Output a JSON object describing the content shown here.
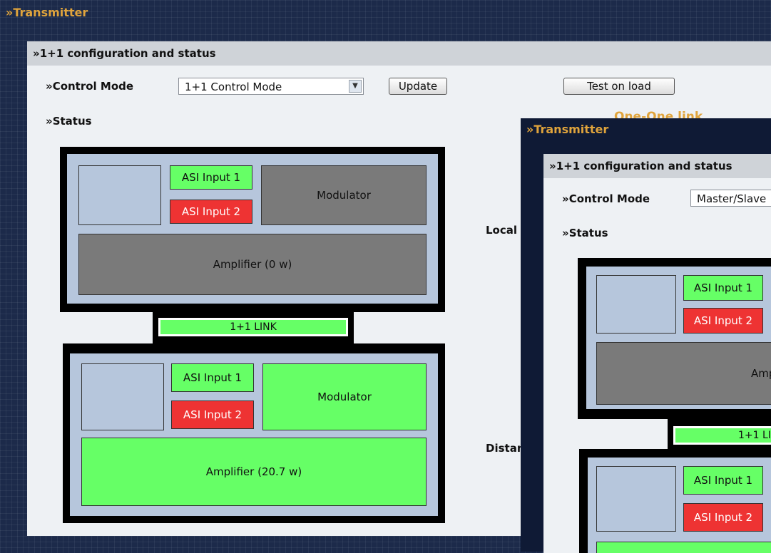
{
  "back_window": {
    "title": "»Transmitter",
    "panel_header": "»1+1 configuration and status",
    "control_mode_label": "»Control Mode",
    "control_mode_value": "1+1 Control Mode",
    "update_button": "Update",
    "test_on_load_button": "Test on  load",
    "status_label": "»Status",
    "link_title": "One-One link",
    "local_label": "Local",
    "distant_label": "Distant",
    "local_unit": {
      "asi_input_1": "ASI Input 1",
      "asi_input_2": "ASI Input 2",
      "modulator": "Modulator",
      "amplifier": "Amplifier (0 w)"
    },
    "link_label": "1+1 LINK",
    "distant_unit": {
      "asi_input_1": "ASI Input 1",
      "asi_input_2": "ASI Input 2",
      "modulator": "Modulator",
      "amplifier": "Amplifier (20.7 w)"
    }
  },
  "front_window": {
    "title": "»Transmitter",
    "panel_header": "»1+1 configuration and status",
    "control_mode_label": "»Control Mode",
    "control_mode_value": "Master/Slave",
    "status_label": "»Status",
    "local_unit": {
      "asi_input_1": "ASI Input 1",
      "asi_input_2": "ASI Input 2",
      "amplifier": "Amplifier"
    },
    "link_label": "1+1 LI",
    "distant_unit": {
      "asi_input_1": "ASI Input 1",
      "asi_input_2": "ASI Input 2"
    }
  },
  "colors": {
    "ok": "#66ff66",
    "fault": "#ee3333",
    "inactive": "#7a7a7a",
    "title_accent": "#e0a43c"
  }
}
